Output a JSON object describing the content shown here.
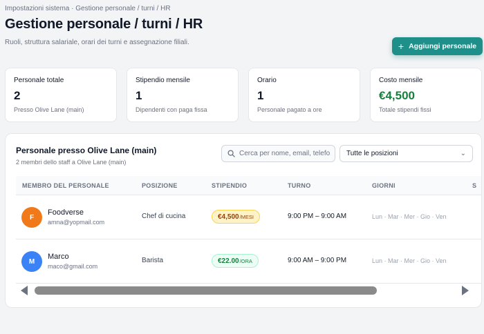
{
  "breadcrumb": "Impostazioni sistema · Gestione personale / turni / HR",
  "title": "Gestione personale / turni / HR",
  "subtitle": "Ruoli, struttura salariale, orari dei turni e assegnazione filiali.",
  "add_button": {
    "label": "Aggiungi personale",
    "icon": "plus-icon",
    "color": "#1f8f8a"
  },
  "stats": [
    {
      "label": "Personale totale",
      "value": "2",
      "note": "Presso Olive Lane (main)"
    },
    {
      "label": "Stipendio mensile",
      "value": "1",
      "note": "Dipendenti con paga fissa"
    },
    {
      "label": "Orario",
      "value": "1",
      "note": "Personale pagato a ore"
    },
    {
      "label": "Costo mensile",
      "value": "€4,500",
      "note": "Totale stipendi fissi",
      "color": "#15803d"
    }
  ],
  "panel": {
    "title": "Personale presso Olive Lane (main)",
    "subtitle": "2 membri dello staff a Olive Lane (main)",
    "search_placeholder": "Cerca per nome, email, telefo",
    "position_filter": "Tutte le posizioni",
    "columns": [
      "MEMBRO DEL PERSONALE",
      "POSIZIONE",
      "STIPENDIO",
      "TURNO",
      "GIORNI",
      "S"
    ],
    "rows": [
      {
        "initial": "F",
        "avatar_color": "#f07a1a",
        "name": "Foodverse",
        "email": "amna@yopmail.com",
        "position": "Chef di cucina",
        "salary": "€4,500",
        "salary_unit": "/MESI",
        "salary_style": "monthly",
        "shift": "9:00 PM – 9:00 AM",
        "days": "Lun · Mar · Mer · Gio · Ven"
      },
      {
        "initial": "M",
        "avatar_color": "#3b82f6",
        "name": "Marco",
        "email": "maco@gmail.com",
        "position": "Barista",
        "salary": "€22.00",
        "salary_unit": "/ORA",
        "salary_style": "hourly",
        "shift": "9:00 AM – 9:00 PM",
        "days": "Lun · Mar · Mer · Gio · Ven"
      }
    ]
  }
}
